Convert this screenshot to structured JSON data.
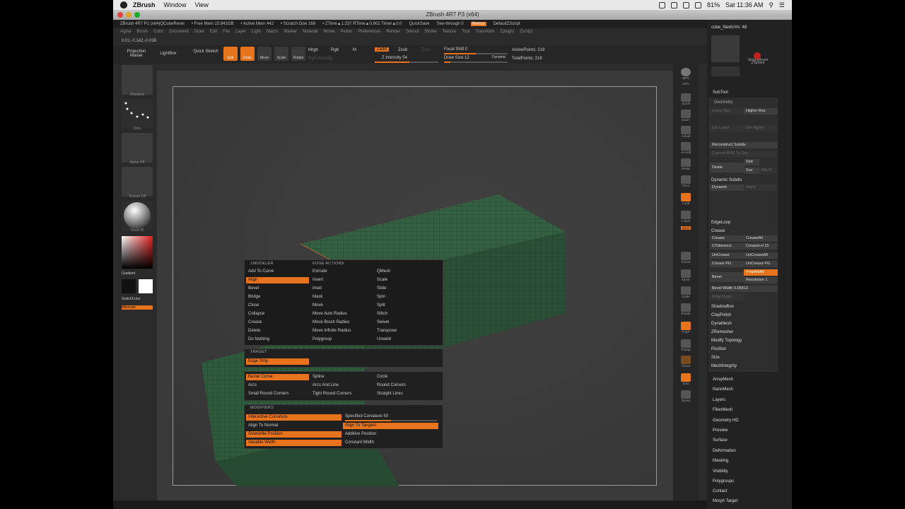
{
  "mac": {
    "app": "ZBrush",
    "menus": [
      "Window",
      "View"
    ],
    "battery": "81%",
    "clock": "Sat 11:36 AM"
  },
  "window_title": "ZBrush 4R7 P3 (x64)",
  "topstrip": [
    "ZBrush 4R7 P1 (x64)QCubeRevel",
    "• Free Mem 15.941GB",
    "• Active Mem 442",
    "• Scratch Disk 168",
    "• ZTime▲1.237 RTime▲0.801 Timer▲0.0",
    "QuickSave",
    "See-through 0",
    "Menus",
    "DefaultZScript"
  ],
  "menubar": [
    "Alpha",
    "Brush",
    "Color",
    "Document",
    "Draw",
    "Edit",
    "File",
    "Layer",
    "Light",
    "Macro",
    "Marker",
    "Material",
    "Movie",
    "Picker",
    "Preferences",
    "Render",
    "Stencil",
    "Stroke",
    "Texture",
    "Tool",
    "Transform",
    "Zplugin",
    "Zscript"
  ],
  "coords": "0.01,-0.142,-0.036",
  "toolbar": {
    "projection_master": "Projection Master",
    "lightbox": "LightBox",
    "quick_sketch": "Quick Sketch",
    "edit": "Edit",
    "draw": "Draw",
    "move": "Move",
    "scale": "Scale",
    "rotate": "Rotate",
    "mrgb": "Mrgb",
    "rgb": "Rgb",
    "m": "M",
    "rgb_intensity": "Rgb Intensity",
    "zadd": "Zadd",
    "zsub": "Zsub",
    "zcut": "Zcut",
    "z_intensity": "Z Intensity 54",
    "focal_shift": "Focal Shift 0",
    "draw_size": "Draw Size 12",
    "dynamic": "Dynamic",
    "active_points": "ActivePoints: 218",
    "total_points": "TotalPoints: 218"
  },
  "left_shelf": [
    "ZModeler",
    "Dots",
    "Alpha Off",
    "Texture Off",
    "Basic M",
    "Gradient",
    "SwitchColor",
    "Alternate"
  ],
  "right_shelf": [
    "BPR",
    "SPix",
    "Scroll",
    "Zoom",
    "Actual",
    "AAHalf",
    "Persp",
    "Floor",
    "Local",
    "L.Sym",
    "Qxyz",
    "Frame",
    "Move",
    "Scale",
    "Rotate",
    "PolyF",
    "Transp",
    "Ghost",
    "Solo",
    "Xpose"
  ],
  "tray": {
    "tool_name": "cube_NextUVs: 48",
    "tools": [
      "cube_NextUVs",
      "SimpleBrush",
      "ZSphere",
      "cube_NextUVs"
    ],
    "subtool": "SubTool",
    "geometry": "Geometry",
    "higher_res": "Higher Res",
    "lower_res": "Lower Res",
    "del_lower": "Del Lower",
    "del_higher": "Del Higher",
    "reconstruct": "Reconstruct Subdiv",
    "convert_bpr": "Convert BPR To Geo",
    "divide": "Divide",
    "smt": "Smt",
    "suv": "Suv",
    "reuv": "ReUV",
    "dynamic_subdiv": "Dynamic Subdiv",
    "dynamic": "Dynamic",
    "apply": "Apply",
    "edgeloop": "EdgeLoop",
    "crease_hdr": "Crease",
    "crease": "Crease",
    "crease_all": "CreaseAll",
    "ctolerance": "CTolerance",
    "crease_lvl": "CreaseLvl 15",
    "uncrease": "UnCrease",
    "uncrease_all": "UnCreaseAll",
    "crease_pg": "Crease PG",
    "uncrease_pg": "UnCrease PG",
    "bevel": "Bevel",
    "prop_width": "PropWidth",
    "resolution": "Resolution 1",
    "bevel_width": "Bevel Width 0.05813",
    "edge_sharp": "EdgeSharp",
    "list": [
      "ShadowBox",
      "ClayPolish",
      "DynaMesh",
      "ZRemesher",
      "Modify Topology",
      "Position",
      "Size",
      "MeshIntegrity"
    ],
    "list2": [
      "ArrayMesh",
      "NanoMesh",
      "Layers",
      "FiberMesh",
      "Geometry HD",
      "Preview",
      "Surface",
      "Deformation",
      "Masking",
      "Visibility",
      "Polygroups",
      "Contact",
      "Morph Target"
    ]
  },
  "popup": {
    "hdr_zmodeler": "ZMODELER",
    "hdr_edge_actions": "EDGE ACTIONS",
    "col1": [
      "Add To Curve",
      "Align",
      "Bevel",
      "Bridge",
      "Close",
      "Collapse",
      "Crease",
      "Delete",
      "Do Nothing"
    ],
    "col2": [
      "Extrude",
      "Insert",
      "Inset",
      "Mask",
      "Move",
      "Move Auto Radius",
      "Move Brush Radius",
      "Move Infinite Radius",
      "Polygroup"
    ],
    "col3": [
      "QMesh",
      "Scale",
      "Slide",
      "Spin",
      "Split",
      "Stitch",
      "Swivel",
      "Transpose",
      "Unweld"
    ],
    "hdr_target": "TARGET",
    "target": "Edge Strip",
    "curve_col1": [
      "Bezier Curve",
      "Arcs",
      "Small Round Corners"
    ],
    "curve_col2": [
      "Spline",
      "Arcs And Line",
      "Tight Round Corners"
    ],
    "curve_col3": [
      "Circle",
      "Round Corners",
      "Straight Lines"
    ],
    "hdr_modifiers": "MODIFIERS",
    "mod_col1": [
      "Interactive Curvature",
      "Align To Normal",
      "Overwrite Position",
      "Variable Width"
    ],
    "mod_col2": [
      "Specified Curvature 50",
      "Align To Tangent",
      "Additive Position",
      "Constant Width"
    ]
  },
  "colors": {
    "accent": "#e8731d",
    "mesh": "#2f5a3c"
  }
}
